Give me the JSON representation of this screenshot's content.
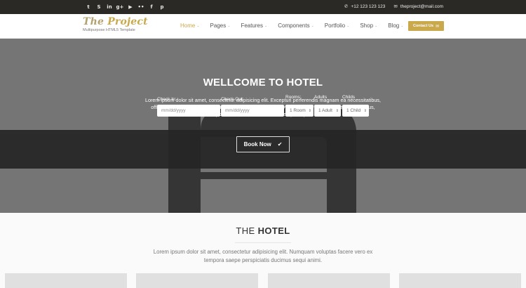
{
  "topbar": {
    "socials": [
      {
        "icon": "twitter-icon",
        "glyph": "t"
      },
      {
        "icon": "skype-icon",
        "glyph": "S"
      },
      {
        "icon": "linkedin-icon",
        "glyph": "in"
      },
      {
        "icon": "google-plus-icon",
        "glyph": "g+"
      },
      {
        "icon": "youtube-icon",
        "glyph": "▶"
      },
      {
        "icon": "flickr-icon",
        "glyph": "••"
      },
      {
        "icon": "facebook-icon",
        "glyph": "f"
      },
      {
        "icon": "pinterest-icon",
        "glyph": "p"
      }
    ],
    "phone": "+12 123 123 123",
    "email": "theproject@mail.com"
  },
  "header": {
    "logo_word1": "The",
    "logo_word2": "Project",
    "tagline": "Multipurpose HTML5 Template",
    "nav": [
      {
        "label": "Home",
        "active": true
      },
      {
        "label": "Pages",
        "active": false
      },
      {
        "label": "Features",
        "active": false
      },
      {
        "label": "Components",
        "active": false
      },
      {
        "label": "Portfolio",
        "active": false
      },
      {
        "label": "Shop",
        "active": false
      },
      {
        "label": "Blog",
        "active": false
      }
    ],
    "contact_button": "Contact Us"
  },
  "hero": {
    "title": "WELLCOME TO HOTEL",
    "text": "Lorem ipsum dolor sit amet, consectetur adipisicing elit. Excepturi perferendis magnam ea necessitatibus, officiis voluptas odit! Aperiam omnis, cupiditate laudantium velit nostrum, exercitationem accusamus, possimus soluta illo deserunt tempora qui."
  },
  "booking": {
    "check_in_label": "Check In:",
    "check_in_placeholder": "mm/dd/yyyy",
    "check_out_label": "Check Out:",
    "check_out_placeholder": "mm/dd/yyyy",
    "rooms_label": "Rooms:",
    "rooms_value": "1 Room",
    "adults_label": "Adults",
    "adults_value": "1 Adult",
    "childs_label": "Childs",
    "childs_value": "1 Child",
    "book_button": "Book Now"
  },
  "section": {
    "title_plain": "THE",
    "title_bold": "HOTEL",
    "text": "Lorem ipsum dolor sit amet, consectetur adipisicing elit. Numquam voluptas facere vero ex tempora saepe perspiciatis ducimus sequi animi."
  },
  "colors": {
    "accent": "#c9a94b",
    "topbar": "#2b2926",
    "hero_bg": "#757575",
    "band": "#262626"
  }
}
